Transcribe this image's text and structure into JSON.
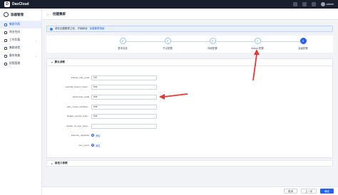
{
  "topbar": {
    "brand": "DaoCloud",
    "user": "admin"
  },
  "sidebar": {
    "title": "容器管理",
    "items": [
      {
        "label": "集群列表",
        "active": true,
        "expand": false
      },
      {
        "label": "命名空间",
        "active": false,
        "expand": false
      },
      {
        "label": "工作负载",
        "active": false,
        "expand": true
      },
      {
        "label": "集群巡检",
        "active": false,
        "expand": false
      },
      {
        "label": "备份恢复",
        "active": false,
        "expand": true
      },
      {
        "label": "权限管理",
        "active": false,
        "expand": false
      }
    ]
  },
  "header": {
    "back": "←",
    "title": "创建集群"
  },
  "notice": {
    "text": "请在创建集群之前，仔细阅读",
    "link": "创建集群指南"
  },
  "steps": [
    {
      "num": "✓",
      "label": "基本信息"
    },
    {
      "num": "✓",
      "label": "节点配置"
    },
    {
      "num": "✓",
      "label": "网络配置"
    },
    {
      "num": "✓",
      "label": "Addon 配置"
    },
    {
      "num": "5",
      "label": "高级配置",
      "current": true
    }
  ],
  "advanced": {
    "section_title": "默认参数",
    "fields": [
      {
        "label": "kubelet_max_pods",
        "value": "110",
        "type": "text"
      },
      {
        "label": "override_system_hostn...",
        "value": "true",
        "type": "select"
      },
      {
        "label": "kubernetes_audit",
        "value": "true",
        "type": "select"
      },
      {
        "label": "auto_renew_certificat...",
        "value": "true",
        "type": "select"
      },
      {
        "label": "disable_service_firew...",
        "value": "true",
        "type": "select"
      },
      {
        "label": "docker_rh_repo_base...",
        "value": "",
        "type": "text"
      },
      {
        "label": "insecure_registries",
        "value": "添加",
        "type": "add"
      },
      {
        "label": "yum_repos",
        "value": "添加",
        "type": "add"
      }
    ]
  },
  "custom": {
    "title": "自定义参数"
  },
  "footer": {
    "cancel": "取消",
    "prev": "上一步",
    "ok": "确定"
  },
  "colors": {
    "accent": "#2563eb",
    "annotation": "#e53935"
  }
}
